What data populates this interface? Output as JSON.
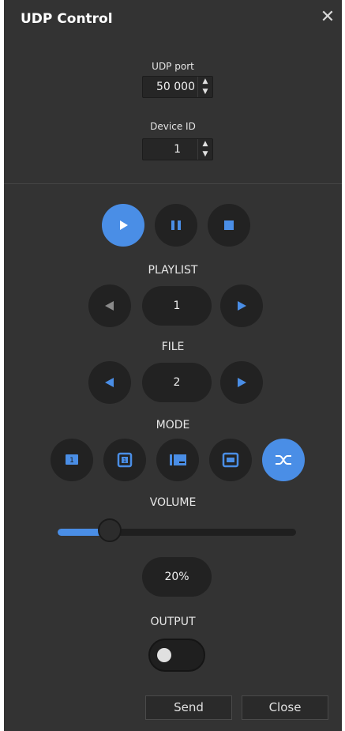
{
  "window": {
    "title": "UDP Control",
    "close_glyph": "✕"
  },
  "udp_port": {
    "label": "UDP port",
    "value": "50 000"
  },
  "device_id": {
    "label": "Device ID",
    "value": "1"
  },
  "transport": {
    "active": "play",
    "icons": [
      "play-icon",
      "pause-icon",
      "stop-icon"
    ]
  },
  "playlist": {
    "label": "PLAYLIST",
    "value": "1"
  },
  "file": {
    "label": "FILE",
    "value": "2"
  },
  "mode": {
    "label": "MODE",
    "options": [
      "play-once-icon",
      "repeat-one-icon",
      "play-all-icon",
      "repeat-all-icon",
      "shuffle-icon"
    ],
    "active": "shuffle-icon"
  },
  "volume": {
    "label": "VOLUME",
    "value_text": "20%",
    "level": 0.2
  },
  "output": {
    "label": "OUTPUT",
    "enabled": false
  },
  "footer": {
    "send_label": "Send",
    "close_label": "Close"
  },
  "colors": {
    "accent": "#4a8ee6",
    "window_bg": "#333333",
    "button_bg": "#222222"
  }
}
